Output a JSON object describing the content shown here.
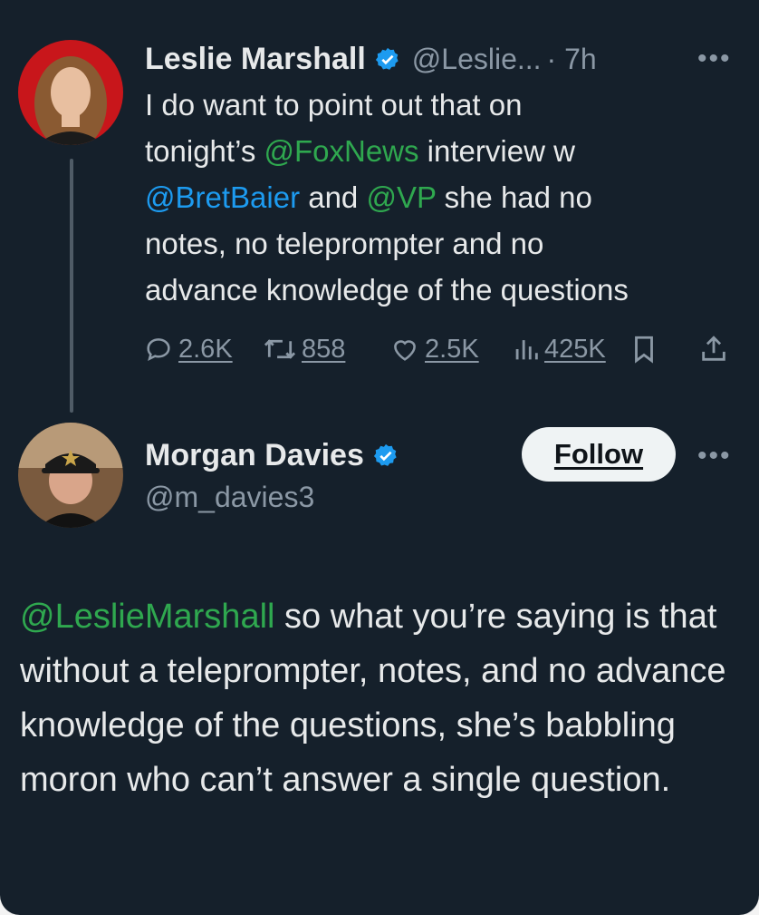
{
  "tweet": {
    "author_name": "Leslie Marshall",
    "handle": "@Leslie...",
    "time": "· 7h",
    "more": "•••",
    "text": {
      "l1": "I do want to point out that on",
      "l2a": "tonight’s ",
      "m_foxnews": "@FoxNews",
      "l2b": " interview w",
      "m_bret": "@BretBaier",
      "l3a": " and ",
      "m_vp": "@VP",
      "l3b": " she had no",
      "l4": "notes, no teleprompter and no",
      "l5": "advance knowledge of the questions"
    },
    "stats": {
      "replies": "2.6K",
      "retweets": "858",
      "likes": "2.5K",
      "views": "425K"
    }
  },
  "reply": {
    "author_name": "Morgan Davies",
    "handle": "@m_davies3",
    "follow_label": "Follow",
    "more": "•••",
    "mention": "@LeslieMarshall",
    "text_rest": " so what you’re saying is that without a teleprompter, notes, and no advance knowledge of the questions, she’s babbling moron who can’t answer a single question."
  },
  "icons": {
    "verified": "verified-badge-icon",
    "reply": "reply-icon",
    "retweet": "retweet-icon",
    "like": "heart-icon",
    "views": "views-icon",
    "bookmark": "bookmark-icon",
    "share": "share-icon"
  },
  "colors": {
    "background": "#15202b",
    "link_blue": "#1d9bf0",
    "link_green": "#2fa84f",
    "verified": "#1d9bf0"
  }
}
